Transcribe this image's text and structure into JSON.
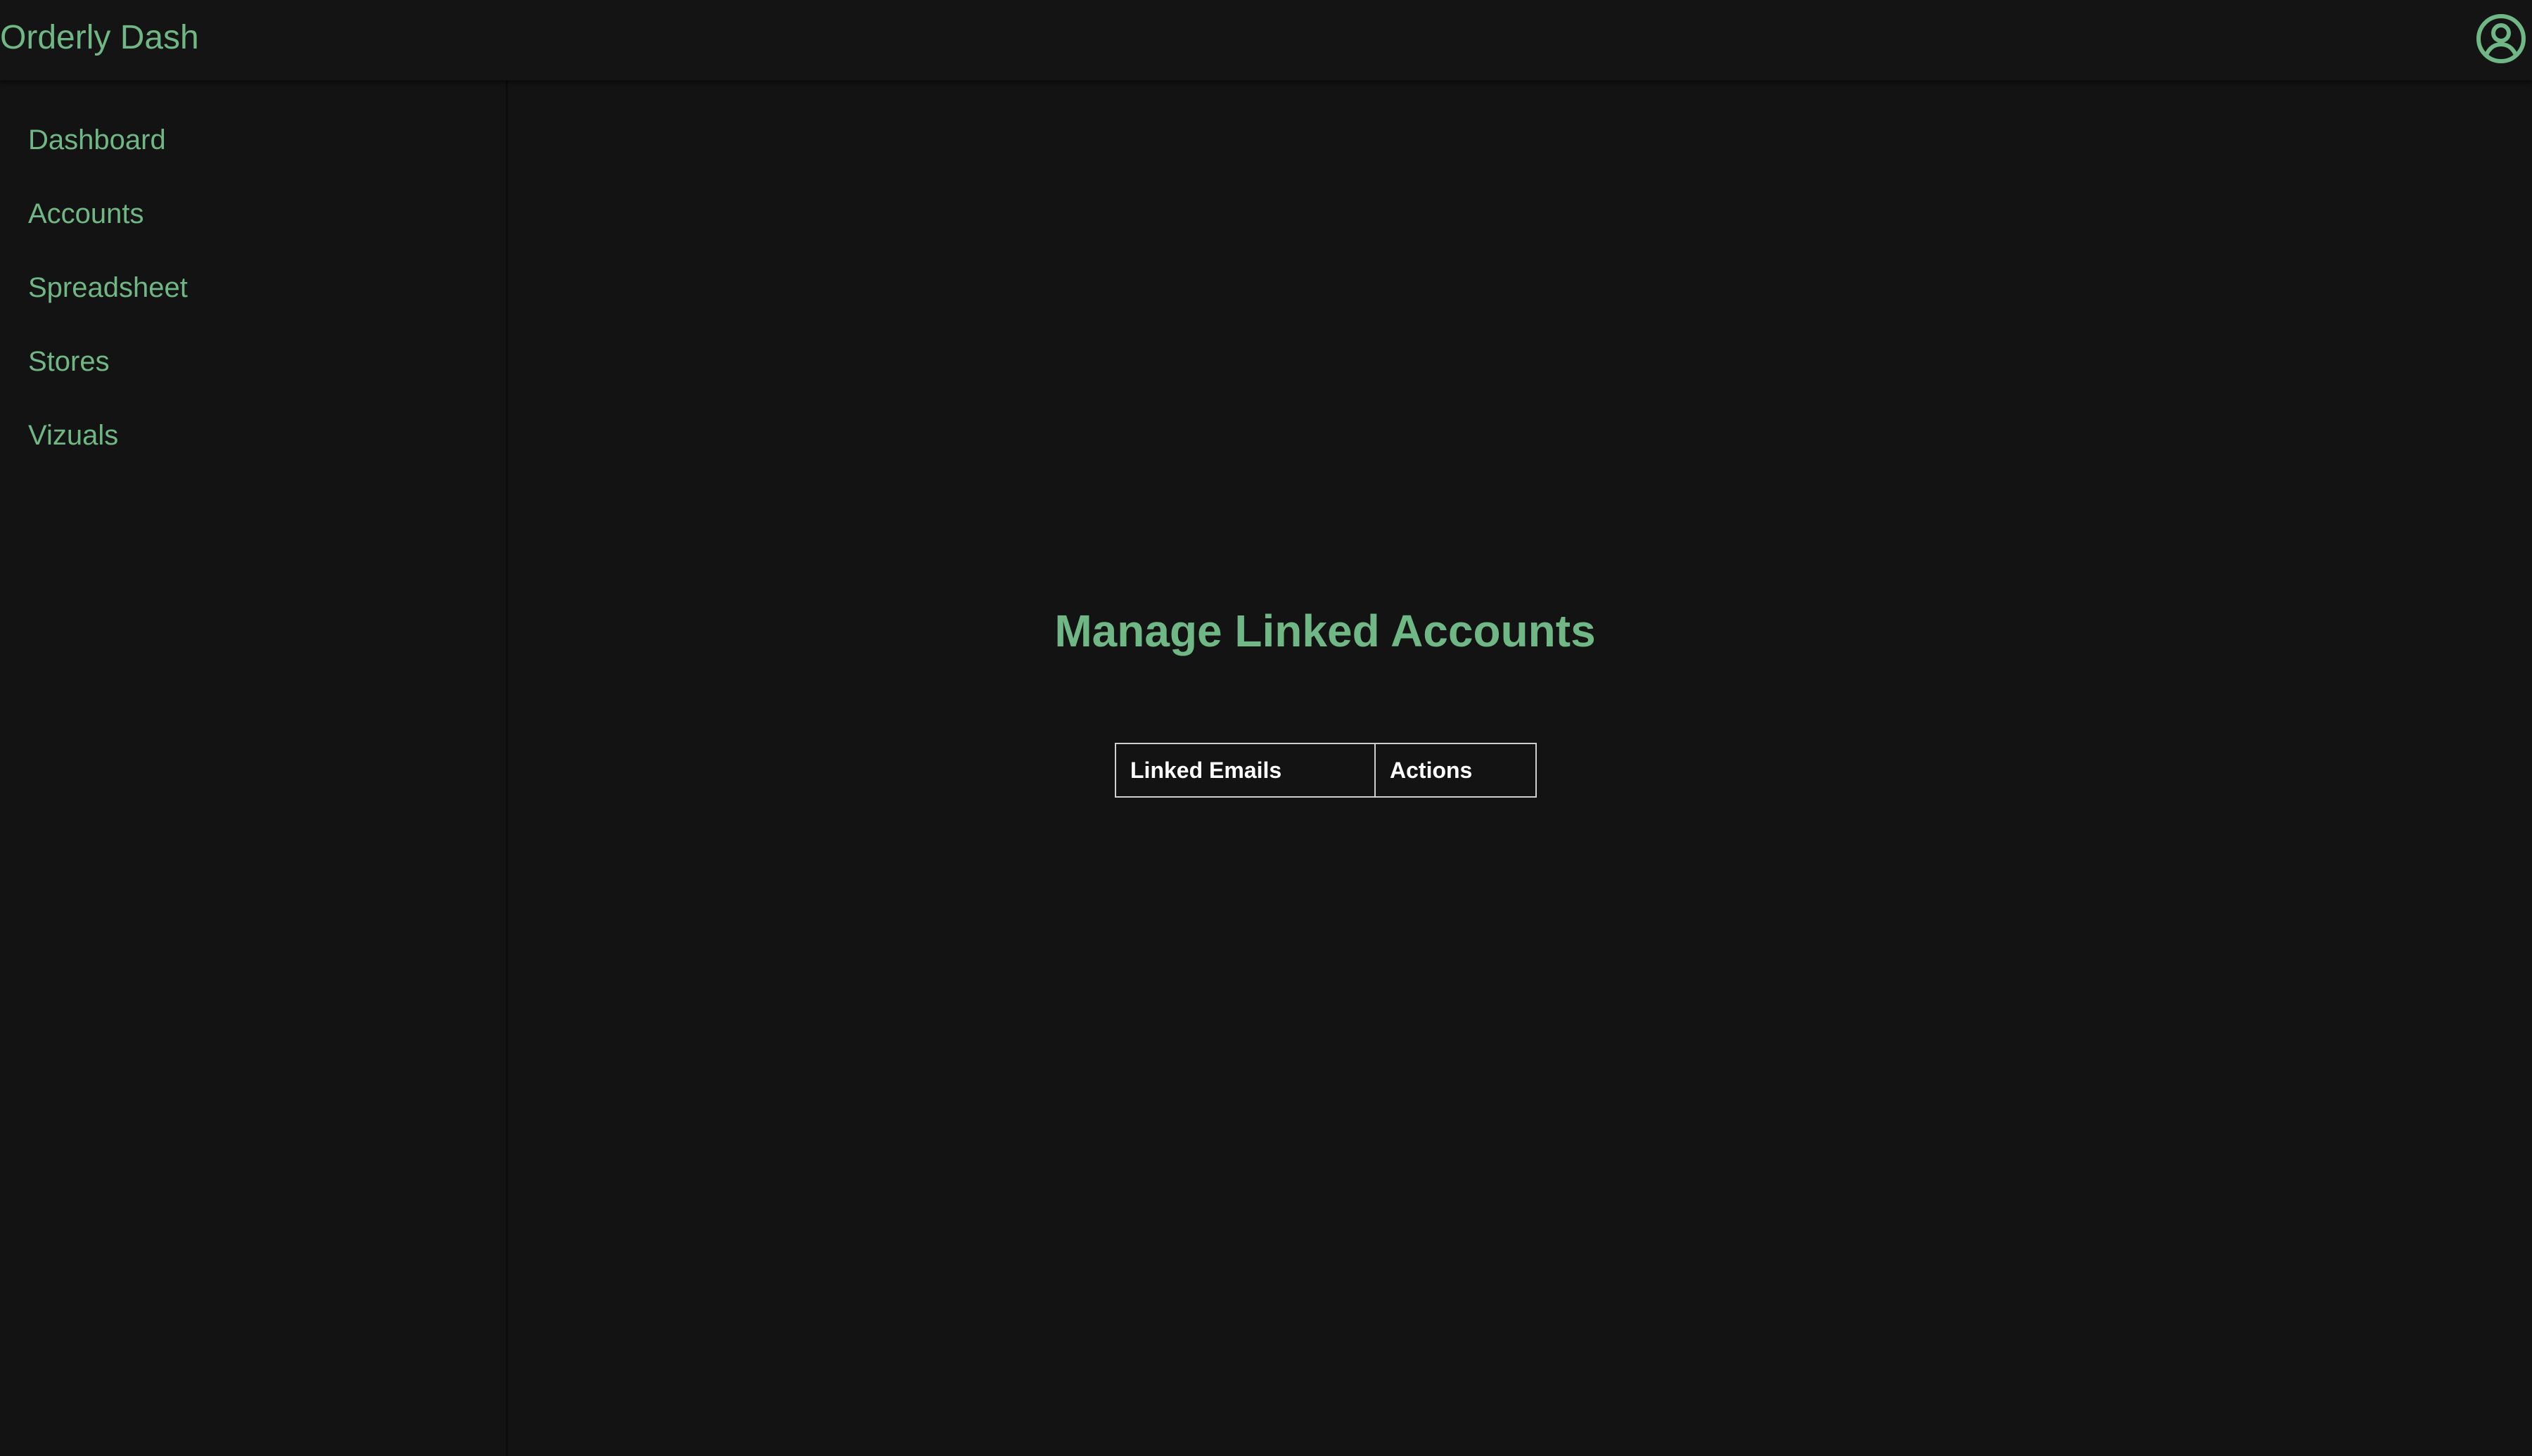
{
  "app": {
    "title": "Orderly Dash",
    "accent_color": "#6fb784",
    "background_color": "#131313"
  },
  "header": {
    "profile_icon": "user-circle-icon"
  },
  "sidebar": {
    "items": [
      {
        "label": "Dashboard"
      },
      {
        "label": "Accounts"
      },
      {
        "label": "Spreadsheet"
      },
      {
        "label": "Stores"
      },
      {
        "label": "Vizuals"
      }
    ]
  },
  "main": {
    "title": "Manage Linked Accounts",
    "table": {
      "columns": [
        "Linked Emails",
        "Actions"
      ],
      "rows": []
    }
  }
}
